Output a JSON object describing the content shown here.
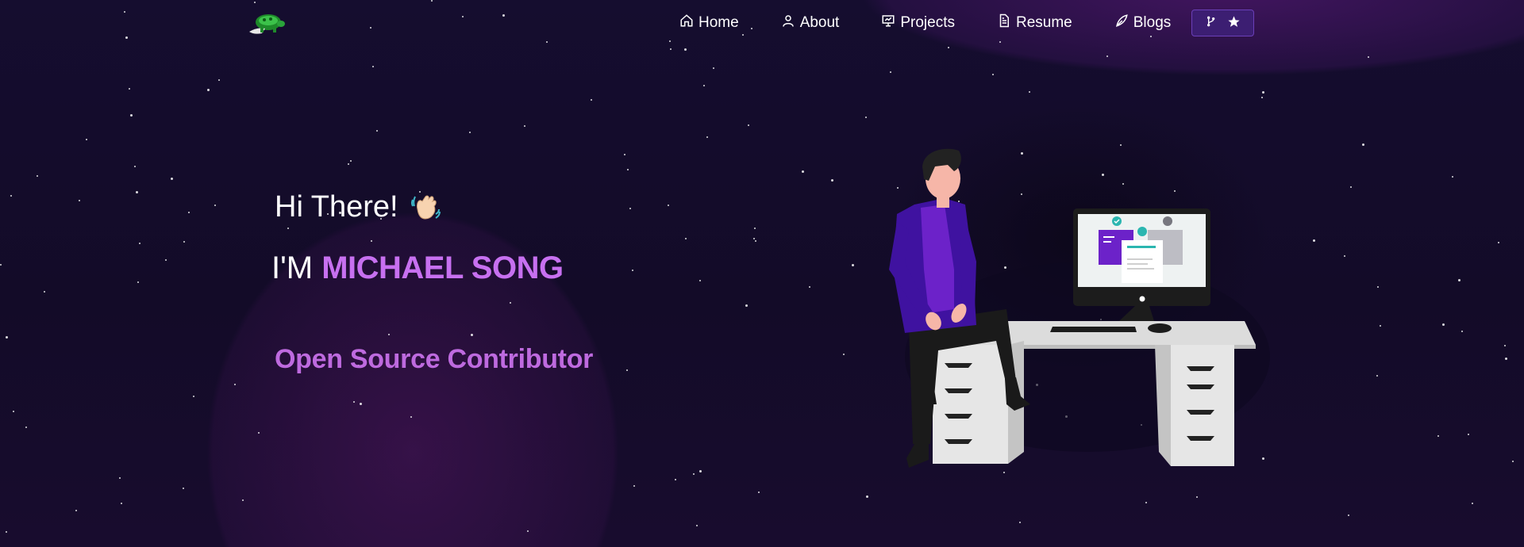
{
  "nav": {
    "logo_icon": "turtle-logo-icon",
    "items": [
      {
        "label": "Home",
        "icon": "home-icon"
      },
      {
        "label": "About",
        "icon": "user-icon"
      },
      {
        "label": "Projects",
        "icon": "presentation-icon"
      },
      {
        "label": "Resume",
        "icon": "document-icon"
      },
      {
        "label": "Blogs",
        "icon": "quill-icon"
      }
    ],
    "fork_button": {
      "icons": [
        "git-fork-icon",
        "star-icon"
      ]
    }
  },
  "hero": {
    "greeting": "Hi There!",
    "wave_icon": "waving-hand-icon",
    "im_prefix": "I'M ",
    "name": "MICHAEL SONG",
    "role": "Open Source Contributor"
  },
  "illustration": {
    "icon": "developer-at-desk-illustration"
  },
  "colors": {
    "background": "#140c2b",
    "accent": "#c770f0",
    "role_text": "#be6adf",
    "button_bg": "#3c1e72",
    "shirt": "#6c22c9",
    "jacket": "#3f12a0"
  }
}
